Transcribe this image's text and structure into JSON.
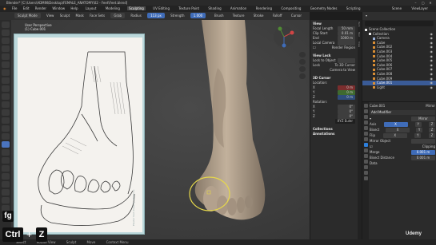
{
  "titlebar": {
    "title": "Blender* [C:\\Users\\ADMIN\\Desktop\\FEMALE_ANATOMY\\02 - Feet\\Feet.blend]",
    "min": "–",
    "max": "▢",
    "close": "✕"
  },
  "menubar": {
    "items": [
      "File",
      "Edit",
      "Render",
      "Window",
      "Help"
    ],
    "workspaces": [
      "Layout",
      "Modeling",
      "Sculpting",
      "UV Editing",
      "Texture Paint",
      "Shading",
      "Animation",
      "Rendering",
      "Compositing",
      "Geometry Nodes",
      "Scripting"
    ],
    "active_workspace": "Sculpting",
    "scene": "Scene",
    "view_layer": "ViewLayer"
  },
  "subheader": {
    "mode": "Sculpt Mode",
    "menus": [
      "View",
      "Sculpt",
      "Mask",
      "Face Sets"
    ],
    "brush": "Grab",
    "radius_label": "Radius",
    "radius": "113 px",
    "strength_label": "Strength",
    "strength": "1.000",
    "right": [
      "Brush",
      "Texture",
      "Stroke",
      "Falloff",
      "Cursor"
    ]
  },
  "viewport": {
    "perspective": "User Perspective",
    "object": "(1) Cube.001",
    "sketch_caption": "Plaster foot drawing reference"
  },
  "npanel": {
    "view_title": "View",
    "focal_label": "Focal Length",
    "focal_value": "50 mm",
    "clip_start_label": "Clip Start",
    "clip_start_value": "0.01 m",
    "end_label": "End",
    "end_value": "1000 m",
    "local_cam_label": "Local Camera",
    "render_region_label": "Render Region",
    "view_lock_title": "View Lock",
    "lock_obj_label": "Lock to Object",
    "lock_label": "Lock",
    "to3d": "To 3D Cursor",
    "camview": "Camera to View",
    "cursor_title": "3D Cursor",
    "location_label": "Location:",
    "loc": [
      "0 m",
      "0 m",
      "0 m"
    ],
    "rotation_label": "Rotation:",
    "rot": [
      "0°",
      "0°",
      "0°"
    ],
    "mode_value": "XYZ Euler",
    "collections_title": "Collections",
    "annotations_title": "Annotations"
  },
  "tabs": [
    "Item",
    "Tool",
    "View"
  ],
  "outliner": {
    "title": "Scene Collection",
    "rows": [
      {
        "name": "Collection",
        "type": "coll",
        "sel": false
      },
      {
        "name": "Camera",
        "type": "cam",
        "sel": false
      },
      {
        "name": "Cube",
        "type": "obj",
        "sel": false
      },
      {
        "name": "Cube.002",
        "type": "obj",
        "sel": false
      },
      {
        "name": "Cube.003",
        "type": "obj",
        "sel": false
      },
      {
        "name": "Cube.004",
        "type": "obj",
        "sel": false
      },
      {
        "name": "Cube.005",
        "type": "obj",
        "sel": false
      },
      {
        "name": "Cube.006",
        "type": "obj",
        "sel": false
      },
      {
        "name": "Cube.007",
        "type": "obj",
        "sel": false
      },
      {
        "name": "Cube.008",
        "type": "obj",
        "sel": false
      },
      {
        "name": "Cube.009",
        "type": "obj",
        "sel": false
      },
      {
        "name": "Cube.001",
        "type": "obj",
        "sel": true
      },
      {
        "name": "Light",
        "type": "obj",
        "sel": false
      }
    ]
  },
  "properties": {
    "object": "Cube.001",
    "modifier_tab": "Mirror",
    "add_modifier": "Add Modifier",
    "modifier_name": "Mirror",
    "axis_label": "Axis",
    "bisect_label": "Bisect",
    "flip_label": "Flip",
    "axes": [
      "X",
      "Y",
      "Z"
    ],
    "mirror_object_label": "Mirror Object",
    "clipping_label": "Clipping",
    "merge_label": "Merge",
    "merge_value": "0.001 m",
    "bisect_dist_label": "Bisect Distance",
    "bisect_dist_value": "0.001 m",
    "data_label": "Data"
  },
  "statusbar": {
    "items": [
      "Select",
      "Rotate View",
      "Sculpt",
      "Move",
      "Context Menu"
    ]
  },
  "keys": {
    "fg": "fg",
    "ctrl": "Ctrl",
    "plus": "+",
    "z": "Z"
  },
  "watermark": "Udemy",
  "colors": {
    "accent": "#3f6cb8",
    "selection_ring": "#e6d84a",
    "sketch_bg": "#bcd8db",
    "skin": "#b5a592"
  }
}
